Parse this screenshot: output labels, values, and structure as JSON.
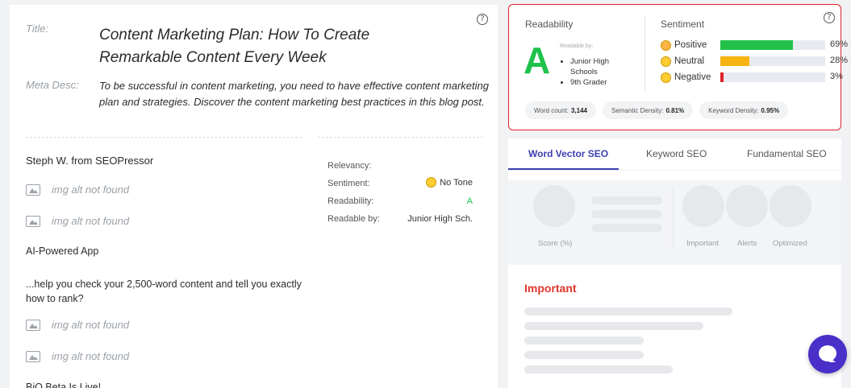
{
  "editor": {
    "title_label": "Title:",
    "title_value": "Content Marketing Plan: How To Create Remarkable Content Every Week",
    "meta_label": "Meta Desc:",
    "meta_value": "To be successful in content marketing, you need to have effective content marketing plan and strategies. Discover the content marketing best practices in this blog post.",
    "help_glyph": "?"
  },
  "result": {
    "title": "Steph W. from SEOPressor",
    "img_alt": "img alt not found",
    "ai_app": "AI-Powered App",
    "snippet": "...help you check your 2,500-word content and tell you exactly how to rank?",
    "beta": "BiO Beta Is Live!",
    "stats": {
      "relevancy_label": "Relevancy:",
      "sentiment_label": "Sentiment:",
      "sentiment_value": "No Tone",
      "readability_label": "Readability:",
      "readability_value": "A",
      "readable_by_label": "Readable by:",
      "readable_by_value": "Junior High Sch."
    }
  },
  "readability_card": {
    "readability_head": "Readability",
    "grade": "A",
    "readable_by_label": "Readable by:",
    "readable_by": [
      "Junior High Schools",
      "9th Grader"
    ],
    "sentiment_head": "Sentiment",
    "help_glyph": "?",
    "sentiments": [
      {
        "label": "Positive",
        "pct_text": "69%",
        "value": 0.69,
        "color": "#22c24a"
      },
      {
        "label": "Neutral",
        "pct_text": "28%",
        "value": 0.28,
        "color": "#f5b40f"
      },
      {
        "label": "Negative",
        "pct_text": "3%",
        "value": 0.03,
        "color": "#e0242a"
      }
    ],
    "word_count_label": "Word count:",
    "word_count_value": "3,144",
    "semantic_label": "Semantic Density:",
    "semantic_value": "0.81%",
    "keyword_label": "Keyword Density:",
    "keyword_value": "0.95%"
  },
  "tabs": {
    "items": [
      "Word Vector SEO",
      "Keyword SEO",
      "Fundamental SEO"
    ],
    "score_label": "Score (%)",
    "important_label": "Important",
    "alerts_label": "Alerts",
    "optimized_label": "Optimized",
    "important_head": "Important"
  },
  "colors": {
    "accent": "#3b3fb0",
    "highlight_border": "#e0242a",
    "grade_green": "#1ec24b",
    "chat_purple": "#4a2fc8"
  }
}
